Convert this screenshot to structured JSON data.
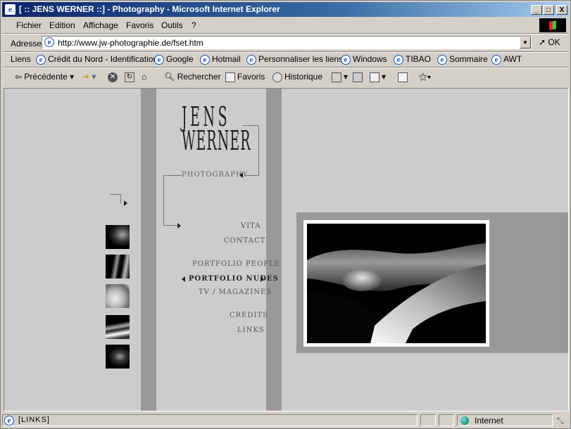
{
  "window": {
    "title": "[ :: JENS WERNER ::] - Photography - Microsoft Internet Explorer",
    "min": "_",
    "max": "□",
    "close": "X"
  },
  "menu": [
    "Fichier",
    "Edition",
    "Affichage",
    "Favoris",
    "Outils",
    "?"
  ],
  "address": {
    "label": "Adresse",
    "url": "http://www.jw-photographie.de/fset.htm",
    "go": "OK"
  },
  "links": {
    "label": "Liens",
    "items": [
      "Crédit du Nord - Identification",
      "Google",
      "Hotmail",
      "Personnaliser les liens",
      "Windows",
      "TIBAO",
      "Sommaire",
      "AWT"
    ]
  },
  "toolbar": {
    "back": "Précédente",
    "search": "Rechercher",
    "favorites": "Favoris",
    "history": "Historique"
  },
  "site": {
    "logo_line1": "JENS",
    "logo_line2": "WERNER",
    "tagline": "PHOTOGRAPHY",
    "nav": [
      "VITA",
      "CONTACT",
      "PORTFOLIO PEOPLE",
      "PORTFOLIO NUDES",
      "TV / MAGAZINES",
      "CREDITS",
      "LINKS"
    ],
    "active_nav": "PORTFOLIO NUDES"
  },
  "status": {
    "text": "[LINKS]",
    "zone": "Internet"
  }
}
